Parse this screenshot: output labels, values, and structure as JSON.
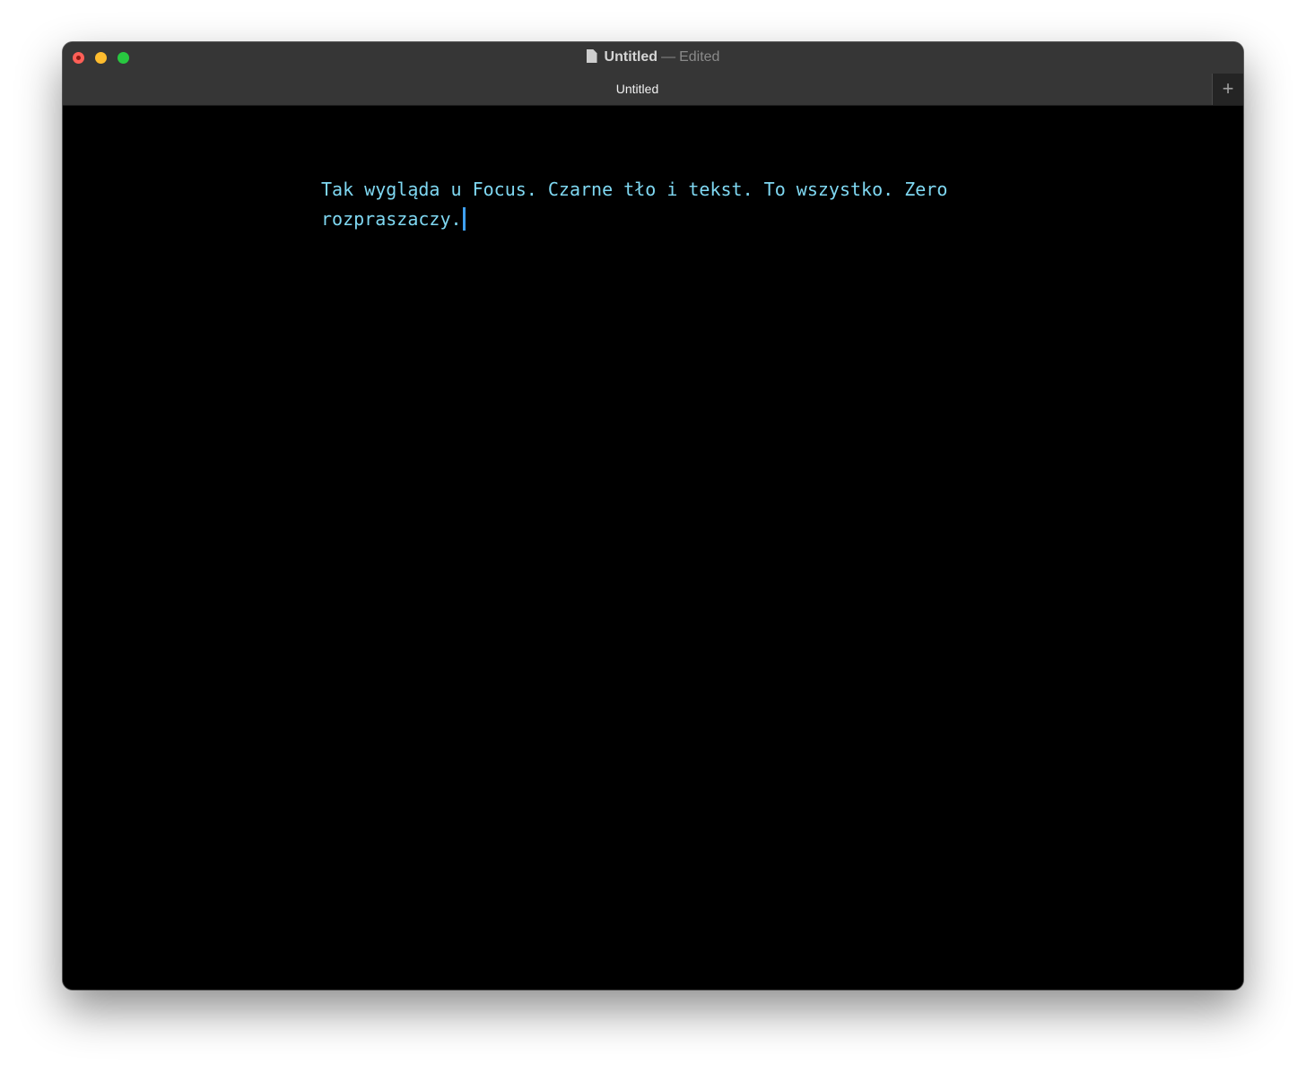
{
  "window": {
    "title": "Untitled",
    "title_separator": "—",
    "status": "Edited",
    "doc_icon": "document-icon"
  },
  "tabs": [
    {
      "label": "Untitled",
      "active": true
    }
  ],
  "new_tab_label": "+",
  "editor": {
    "lines": [
      "Tak wygląda u Focus. Czarne tło i tekst. To wszystko. Zero",
      "rozpraszaczy."
    ],
    "text_color": "#7fd8f2",
    "caret_color": "#3fa0f0",
    "background": "#000000"
  }
}
